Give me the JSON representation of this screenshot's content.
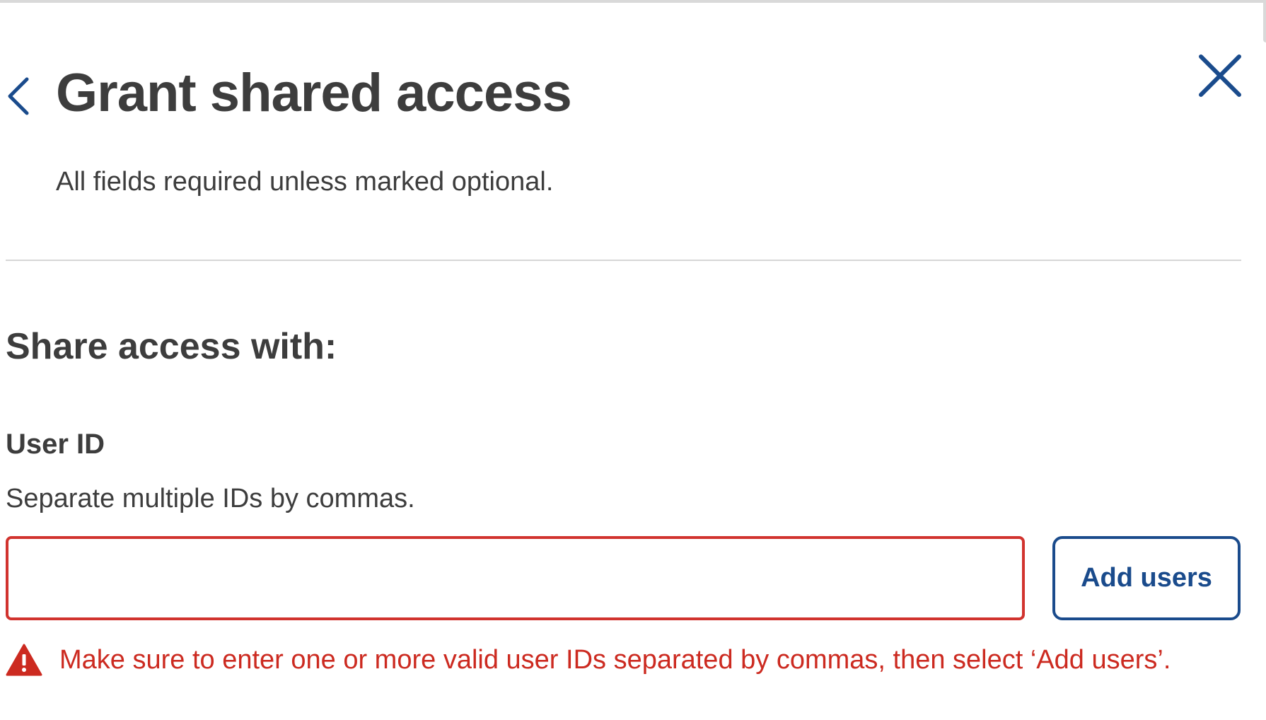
{
  "header": {
    "title": "Grant shared access",
    "back_icon": "chevron-left-icon",
    "close_icon": "close-icon",
    "accent_color": "#1a4b8c"
  },
  "form": {
    "required_note": "All fields required unless marked optional.",
    "section_title": "Share access with:",
    "user_id": {
      "label": "User ID",
      "hint": "Separate multiple IDs by commas.",
      "value": "",
      "placeholder": "",
      "state": "error"
    },
    "add_users_label": "Add users",
    "error": {
      "icon": "warning-icon",
      "message": "Make sure to enter one or more valid user IDs separated by commas, then select ‘Add users’.",
      "color": "#cc2a20"
    }
  }
}
